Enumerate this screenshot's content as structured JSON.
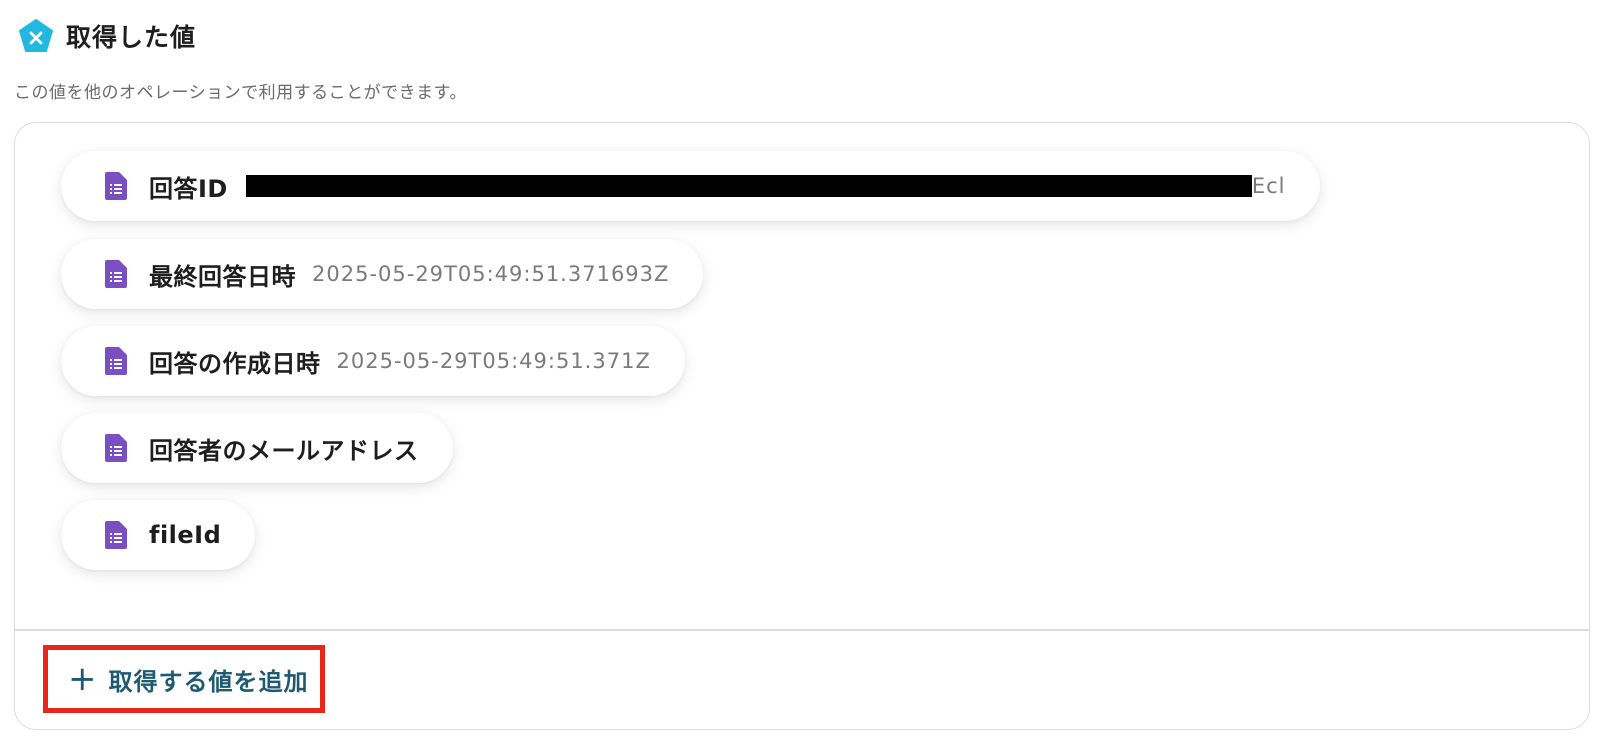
{
  "header": {
    "title": "取得した値",
    "badge_icon": "x-pentagon-icon",
    "badge_color": "#22b8e0"
  },
  "subtitle": "この値を他のオペレーションで利用することができます。",
  "values": [
    {
      "label": "回答ID",
      "value": "Ecl",
      "redacted": true,
      "icon": "document-icon"
    },
    {
      "label": "最終回答日時",
      "value": "2025-05-29T05:49:51.371693Z",
      "icon": "document-icon"
    },
    {
      "label": "回答の作成日時",
      "value": "2025-05-29T05:49:51.371Z",
      "icon": "document-icon"
    },
    {
      "label": "回答者のメールアドレス",
      "value": "",
      "icon": "document-icon"
    },
    {
      "label": "fileId",
      "value": "",
      "icon": "document-icon"
    }
  ],
  "add_button": {
    "icon": "+",
    "label": "取得する値を追加"
  },
  "colors": {
    "doc_icon": "#7b4fc2",
    "accent_text": "#1f5a73",
    "highlight_border": "#e8271c"
  }
}
